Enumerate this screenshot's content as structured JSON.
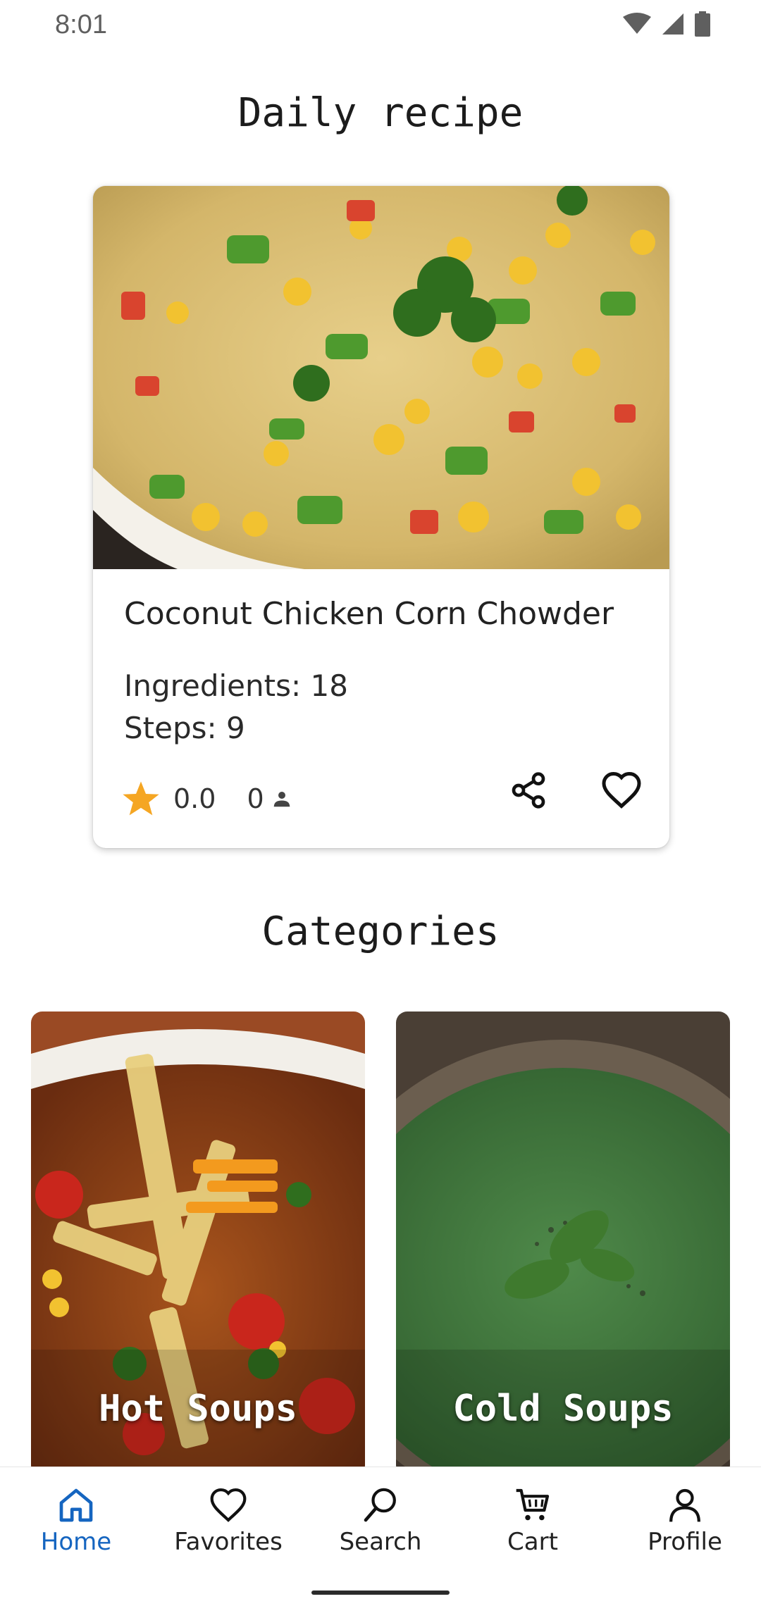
{
  "status_bar": {
    "time": "8:01"
  },
  "daily": {
    "title": "Daily recipe"
  },
  "recipe": {
    "name": "Coconut Chicken Corn Chowder",
    "ingredients": "Ingredients: 18",
    "steps": "Steps: 9",
    "rating": "0.0",
    "reviews": "0",
    "icons": {
      "star": "star-icon",
      "people": "person-icon",
      "share": "share-icon",
      "favorite": "heart-icon"
    }
  },
  "categories": {
    "title": "Categories",
    "items": [
      {
        "label": "Hot Soups"
      },
      {
        "label": "Cold Soups"
      }
    ]
  },
  "nav": {
    "items": [
      {
        "label": "Home",
        "icon": "home-icon",
        "active": true
      },
      {
        "label": "Favorites",
        "icon": "heart-icon"
      },
      {
        "label": "Search",
        "icon": "search-icon"
      },
      {
        "label": "Cart",
        "icon": "cart-icon"
      },
      {
        "label": "Profile",
        "icon": "person-icon"
      }
    ]
  },
  "colors": {
    "accent": "#1565c0",
    "star": "#f5a623"
  }
}
